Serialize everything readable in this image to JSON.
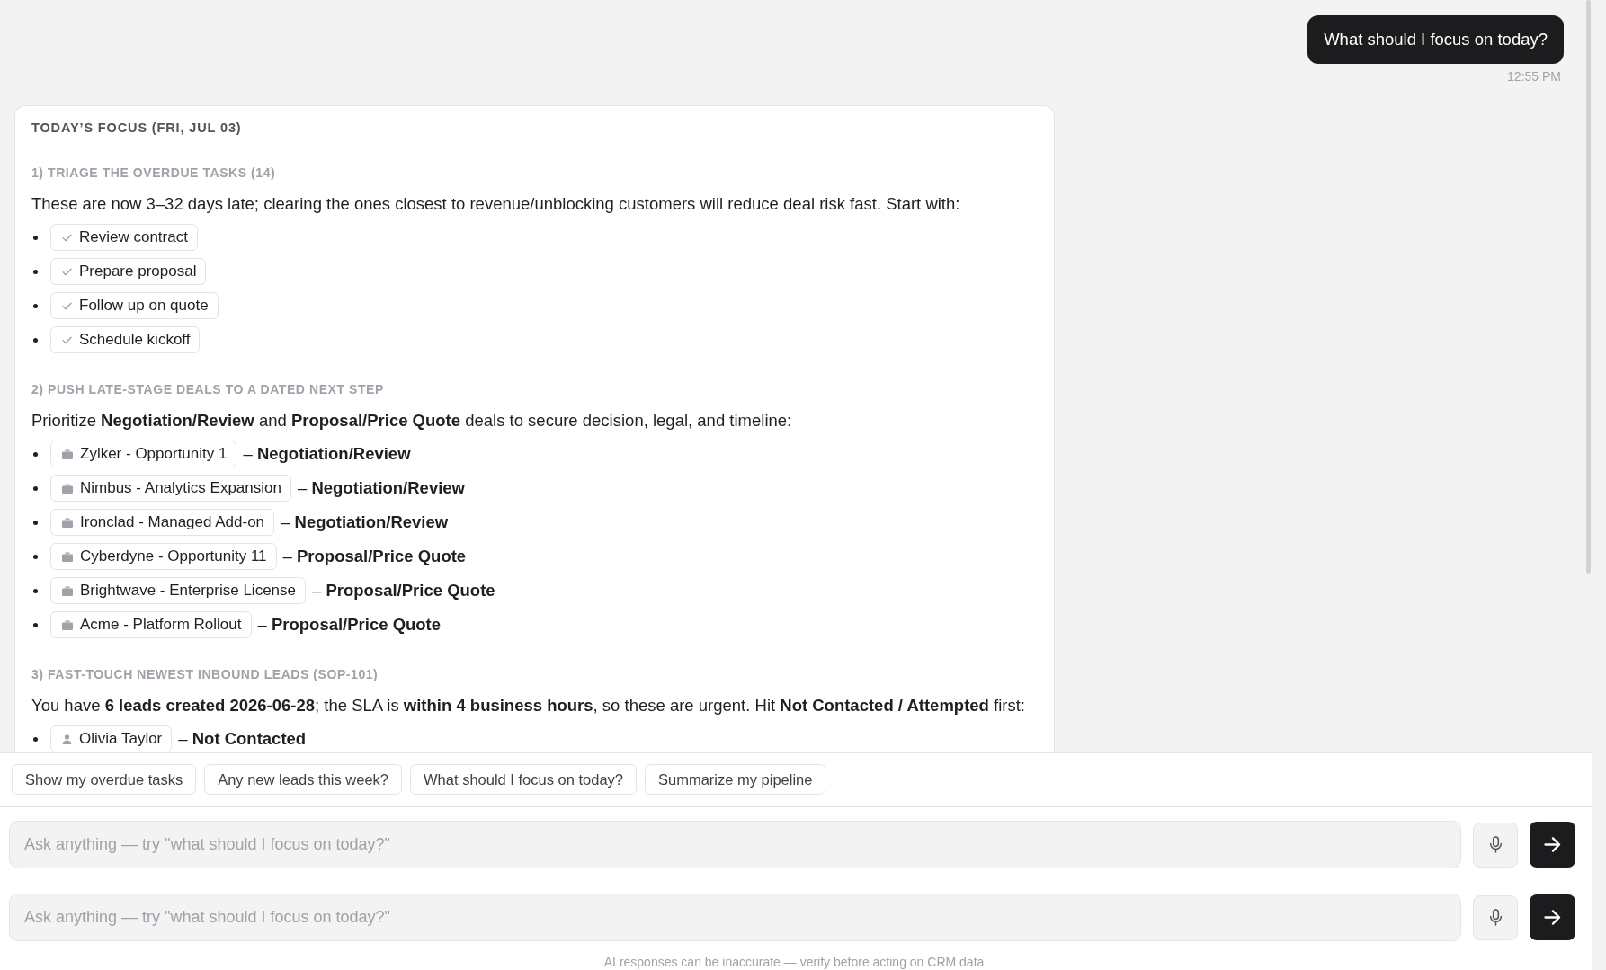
{
  "conversation": {
    "user_message": {
      "text": "What should I focus on today?",
      "time": "12:55 PM"
    },
    "response": {
      "title": "TODAY’S FOCUS (FRI, JUL 03)",
      "sections": [
        {
          "heading": "1) TRIAGE THE OVERDUE TASKS (14)",
          "intro": "These are now 3–32 days late; clearing the ones closest to revenue/unblocking customers will reduce deal risk fast. Start with:",
          "items": [
            {
              "kind": "task",
              "label": "Review contract"
            },
            {
              "kind": "task",
              "label": "Prepare proposal"
            },
            {
              "kind": "task",
              "label": "Follow up on quote"
            },
            {
              "kind": "task",
              "label": "Schedule kickoff"
            }
          ]
        },
        {
          "heading": "2) PUSH LATE-STAGE DEALS TO A DATED NEXT STEP",
          "intro": "Prioritize **Negotiation/Review** and **Proposal/Price Quote** deals to secure decision, legal, and timeline:",
          "items": [
            {
              "kind": "deal",
              "label": "Zylker - Opportunity 1",
              "detail": "– **Negotiation/Review**"
            },
            {
              "kind": "deal",
              "label": "Nimbus - Analytics Expansion",
              "detail": "– **Negotiation/Review**"
            },
            {
              "kind": "deal",
              "label": "Ironclad - Managed Add-on",
              "detail": "– **Negotiation/Review**"
            },
            {
              "kind": "deal",
              "label": "Cyberdyne - Opportunity 11",
              "detail": "– **Proposal/Price Quote**"
            },
            {
              "kind": "deal",
              "label": "Brightwave - Enterprise License",
              "detail": "– **Proposal/Price Quote**"
            },
            {
              "kind": "deal",
              "label": "Acme - Platform Rollout",
              "detail": "– **Proposal/Price Quote**"
            }
          ]
        },
        {
          "heading": "3) FAST-TOUCH NEWEST INBOUND LEADS (SOP-101)",
          "intro": "You have **6 leads created 2026-06-28**; the SLA is **within 4 business hours**, so these are urgent. Hit **Not Contacted / Attempted** first:",
          "items": [
            {
              "kind": "lead",
              "label": "Olivia Taylor",
              "detail": "– **Not Contacted**"
            }
          ]
        }
      ]
    }
  },
  "suggestions": [
    "Show my overdue tasks",
    "Any new leads this week?",
    "What should I focus on today?",
    "Summarize my pipeline"
  ],
  "composers": [
    {
      "placeholder": "Ask anything — try \"what should I focus on today?\""
    },
    {
      "placeholder": "Ask anything — try \"what should I focus on today?\"",
      "disclaimer": "AI responses can be inaccurate — verify before acting on CRM data."
    }
  ]
}
